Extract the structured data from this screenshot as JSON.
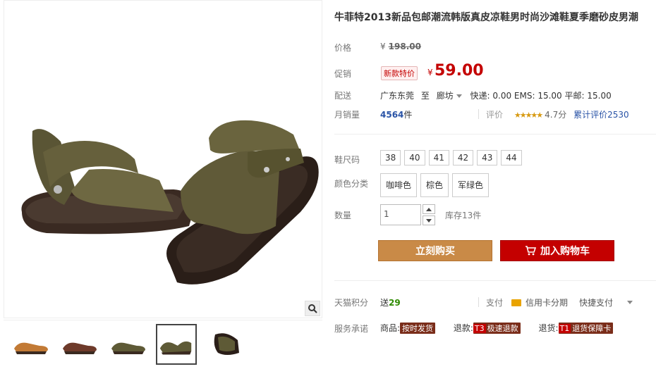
{
  "product": {
    "title": "牛菲特2013新品包邮潮流韩版真皮凉鞋男时尚沙滩鞋夏季磨砂皮男潮"
  },
  "price": {
    "label": "价格",
    "currency": "¥",
    "original": "198.00"
  },
  "promo": {
    "label": "促销",
    "tag": "新款特价",
    "currency": "¥",
    "price": "59.00"
  },
  "shipping": {
    "label": "配送",
    "from": "广东东莞",
    "to_word": "至",
    "destination": "廊坊",
    "fees": "快递: 0.00 EMS: 15.00 平邮: 15.00"
  },
  "sales": {
    "label": "月销量",
    "count": "4564",
    "unit": "件"
  },
  "rating": {
    "label": "评价",
    "stars": "★★★★★",
    "score": "4.7分",
    "total": "累计评价2530"
  },
  "sizes": {
    "label": "鞋尺码",
    "options": [
      "38",
      "40",
      "41",
      "42",
      "43",
      "44"
    ]
  },
  "colors": {
    "label": "颜色分类",
    "options": [
      "咖啡色",
      "棕色",
      "军绿色"
    ]
  },
  "quantity": {
    "label": "数量",
    "value": "1",
    "stock": "库存13件"
  },
  "actions": {
    "buy_now": "立刻购买",
    "add_cart": "加入购物车"
  },
  "points": {
    "label": "天猫积分",
    "text": "送",
    "value": "29"
  },
  "payment": {
    "label": "支付",
    "card": "信用卡分期",
    "quick": "快捷支付"
  },
  "service": {
    "label": "服务承诺",
    "goods_label": "商品:",
    "goods_tag": "按时发货",
    "refund_label": "退款:",
    "refund_badge": "T3",
    "refund_tag": "极速退款",
    "return_label": "退货:",
    "return_badge": "T1",
    "return_tag": "退货保障卡"
  },
  "colors_theme": {
    "price_red": "#c40000",
    "buy_orange": "#c98a47",
    "link_blue": "#2953a6"
  }
}
